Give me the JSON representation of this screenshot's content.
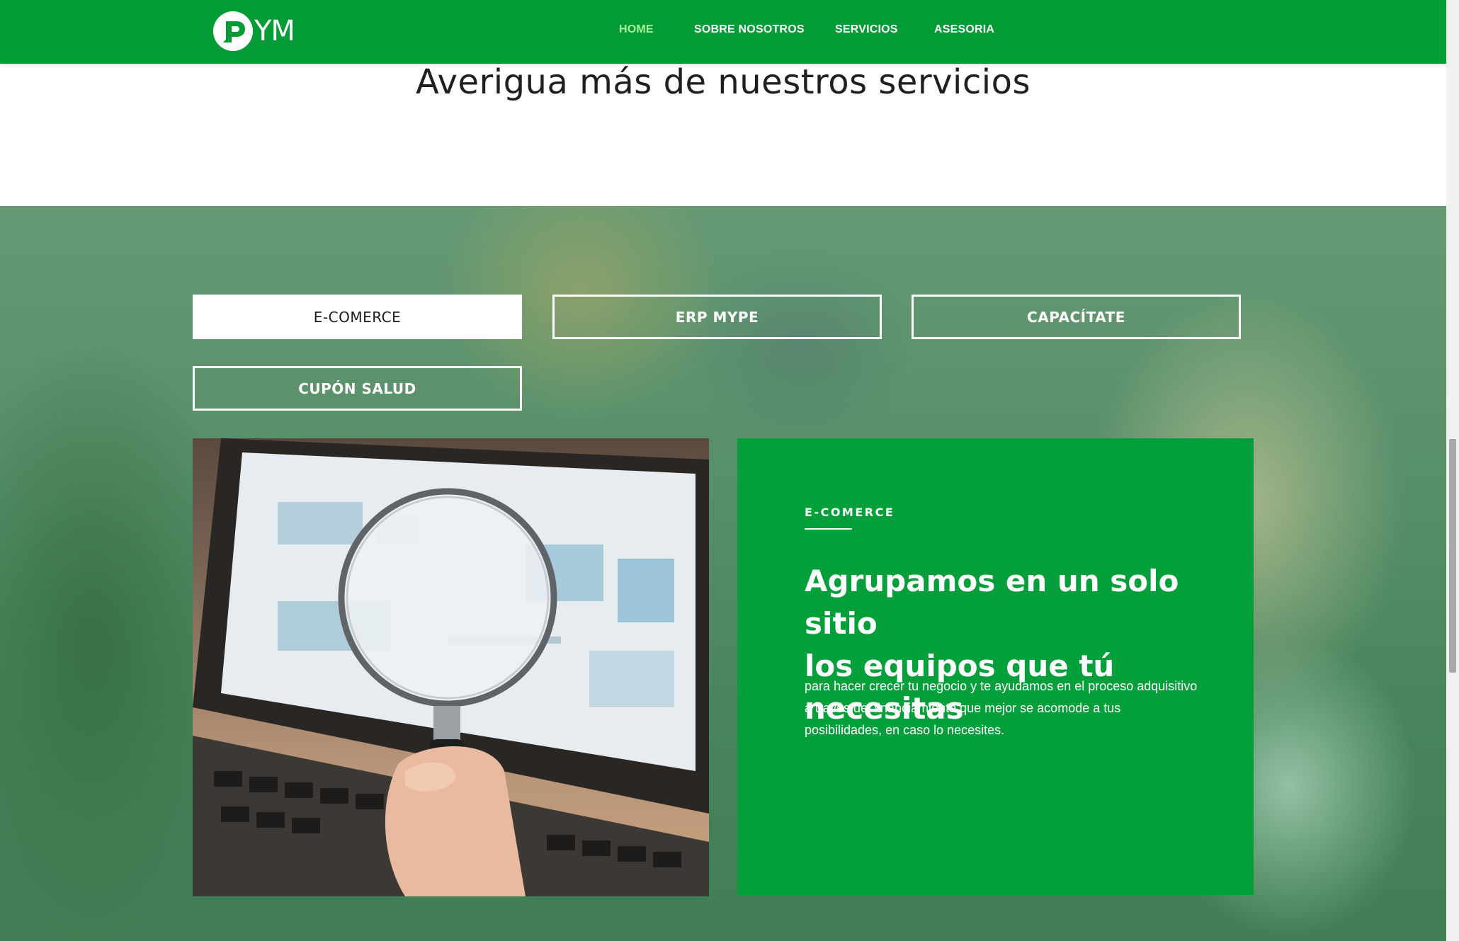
{
  "header": {
    "logo_text": "YM",
    "nav": [
      {
        "label": "HOME",
        "active": true
      },
      {
        "label": "SOBRE NOSOTROS",
        "active": false
      },
      {
        "label": "SERVICIOS",
        "active": false
      },
      {
        "label": "ASESORIA",
        "active": false
      }
    ]
  },
  "intro": {
    "title": "Averigua más de nuestros servicios"
  },
  "tabs": [
    {
      "label": "E-COMERCE",
      "active": true
    },
    {
      "label": "ERP MYPE",
      "active": false
    },
    {
      "label": "CAPACÍTATE",
      "active": false
    },
    {
      "label": "CUPÓN SALUD",
      "active": false
    }
  ],
  "card": {
    "eyebrow": "E-COMERCE",
    "title_line1": "Agrupamos en un solo sitio",
    "title_line2": "los equipos que tú necesitas",
    "body_line1": "para hacer crecer tu negocio y te ayudamos en el proceso adquisitivo",
    "body_line2": "a través del financiamiento que mejor se acomode a tus",
    "body_line3": "posibilidades, en caso lo necesites."
  },
  "colors": {
    "brand_green": "#029b36",
    "card_green": "#029f3a",
    "nav_active": "#a8f59a"
  },
  "icons": [
    "logo-p-icon",
    "magnifier-image"
  ]
}
